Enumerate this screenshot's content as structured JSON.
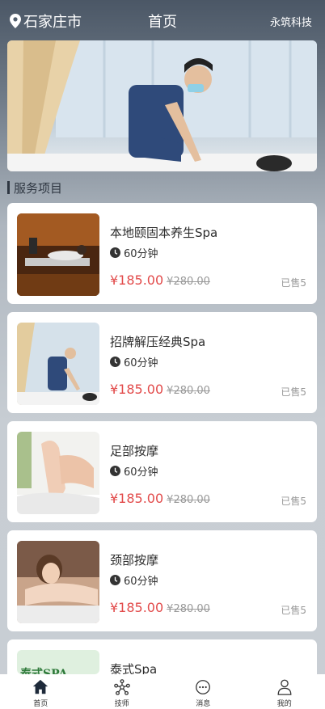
{
  "header": {
    "location": "石家庄市",
    "title": "首页",
    "brand": "永筑科技"
  },
  "section": {
    "title": "服务项目"
  },
  "services": [
    {
      "name": "本地颐固本养生Spa",
      "duration": "60分钟",
      "price": "¥185.00",
      "original_price": "¥280.00",
      "sold": "已售5"
    },
    {
      "name": "招牌解压经典Spa",
      "duration": "60分钟",
      "price": "¥185.00",
      "original_price": "¥280.00",
      "sold": "已售5"
    },
    {
      "name": "足部按摩",
      "duration": "60分钟",
      "price": "¥185.00",
      "original_price": "¥280.00",
      "sold": "已售5"
    },
    {
      "name": "颈部按摩",
      "duration": "60分钟",
      "price": "¥185.00",
      "original_price": "¥280.00",
      "sold": "已售5"
    },
    {
      "name": "泰式Spa",
      "thumb_text": "泰式SPA"
    }
  ],
  "tabbar": {
    "items": [
      {
        "label": "首页",
        "icon": "home-icon"
      },
      {
        "label": "技师",
        "icon": "network-icon"
      },
      {
        "label": "消息",
        "icon": "chat-icon"
      },
      {
        "label": "我的",
        "icon": "user-icon"
      }
    ]
  },
  "colors": {
    "price": "#e24b4b",
    "accent_dark": "#2f3742",
    "muted": "#999999"
  }
}
